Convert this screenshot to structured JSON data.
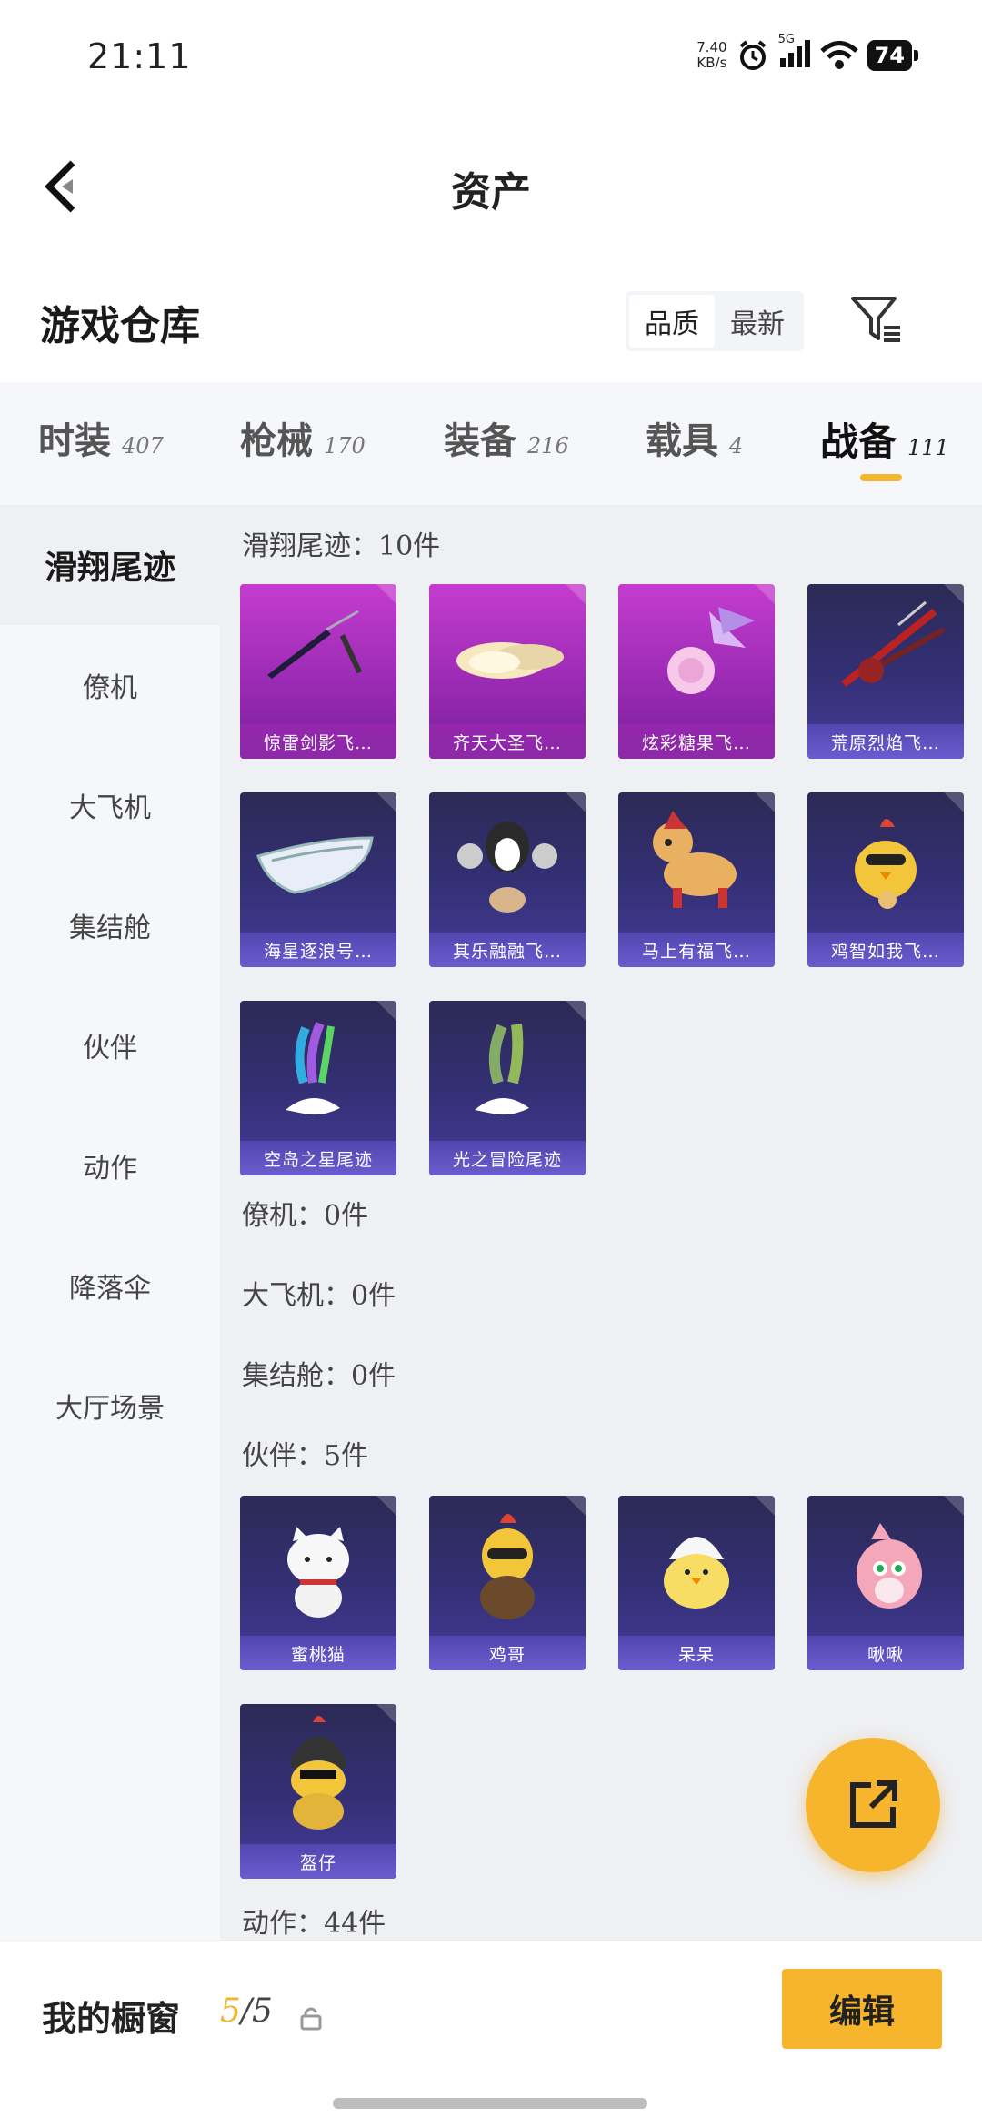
{
  "status": {
    "time": "21:11",
    "speed_value": "7.40",
    "speed_unit": "KB/s",
    "network": "5G",
    "battery": "74"
  },
  "header": {
    "title": "资产"
  },
  "warehouse": {
    "title": "游戏仓库",
    "sort_options": [
      "品质",
      "最新"
    ],
    "active_sort": "品质"
  },
  "tabs": [
    {
      "label": "时装",
      "count": "407"
    },
    {
      "label": "枪械",
      "count": "170"
    },
    {
      "label": "装备",
      "count": "216"
    },
    {
      "label": "载具",
      "count": "4"
    },
    {
      "label": "战备",
      "count": "111",
      "active": true
    }
  ],
  "sidebar": [
    "滑翔尾迹",
    "僚机",
    "大飞机",
    "集结舱",
    "伙伴",
    "动作",
    "降落伞",
    "大厅场景"
  ],
  "sections": {
    "glide": {
      "label": "滑翔尾迹：10件",
      "items": [
        "惊雷剑影飞…",
        "齐天大圣飞…",
        "炫彩糖果飞…",
        "荒原烈焰飞…",
        "海星逐浪号…",
        "其乐融融飞…",
        "马上有福飞…",
        "鸡智如我飞…",
        "空岛之星尾迹",
        "光之冒险尾迹"
      ]
    },
    "wingman": {
      "label": "僚机：0件"
    },
    "plane": {
      "label": "大飞机：0件"
    },
    "pod": {
      "label": "集结舱：0件"
    },
    "partner": {
      "label": "伙伴：5件",
      "items": [
        "蜜桃猫",
        "鸡哥",
        "呆呆",
        "啾啾",
        "盔仔"
      ]
    },
    "action": {
      "label": "动作：44件"
    }
  },
  "bottom": {
    "showcase_label": "我的橱窗",
    "showcase_num": "5",
    "showcase_total": "/5",
    "edit_label": "编辑"
  },
  "colors": {
    "accent": "#f6b52c",
    "purple_card": "#b035c4",
    "blue_card": "#3a3480"
  }
}
